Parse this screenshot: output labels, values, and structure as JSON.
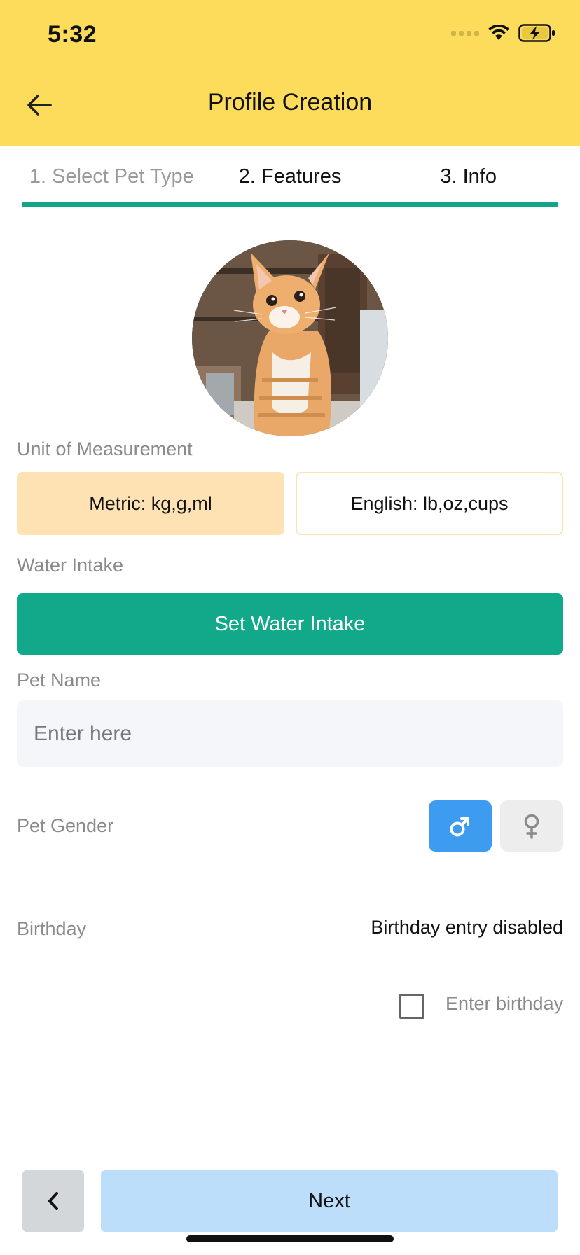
{
  "status_bar": {
    "time": "5:32"
  },
  "header": {
    "title": "Profile Creation"
  },
  "tabs": [
    {
      "label": "1. Select Pet Type",
      "state": "completed"
    },
    {
      "label": "2. Features",
      "state": "completed"
    },
    {
      "label": "3. Info",
      "state": "active"
    }
  ],
  "colors": {
    "header_bg": "#FDDC5C",
    "accent_green": "#13A58C",
    "metric_selected": "#FEE2B3",
    "male_selected": "#3D9CF0",
    "next_button": "#BDDEFB"
  },
  "form": {
    "unit_label": "Unit of Measurement",
    "unit_options": [
      {
        "label": "Metric: kg,g,ml",
        "selected": true
      },
      {
        "label": "English: lb,oz,cups",
        "selected": false
      }
    ],
    "water_label": "Water Intake",
    "water_button": "Set Water Intake",
    "name_label": "Pet Name",
    "name_value": "",
    "name_placeholder": "Enter here",
    "gender_label": "Pet Gender",
    "gender_options": [
      {
        "icon": "male-icon",
        "selected": true
      },
      {
        "icon": "female-icon",
        "selected": false
      }
    ],
    "birthday_label": "Birthday",
    "birthday_status": "Birthday entry disabled",
    "birthday_checkbox_label": "Enter birthday",
    "birthday_checked": false
  },
  "footer": {
    "next_label": "Next"
  }
}
